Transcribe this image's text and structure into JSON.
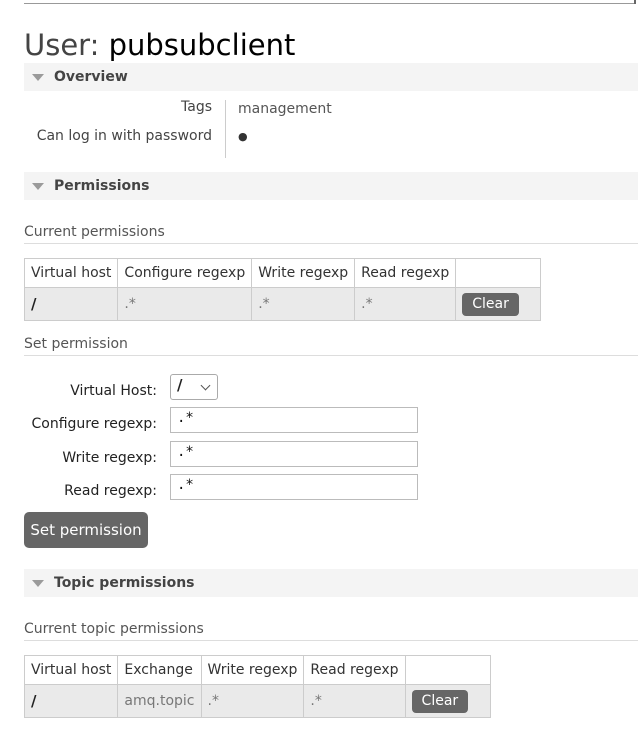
{
  "page": {
    "title_prefix": "User:",
    "user_name": "pubsubclient"
  },
  "overview": {
    "heading": "Overview",
    "tags_label": "Tags",
    "tags_value": "management",
    "password_label": "Can log in with password",
    "password_value": "●"
  },
  "permissions": {
    "heading": "Permissions",
    "current_heading": "Current permissions",
    "columns": [
      "Virtual host",
      "Configure regexp",
      "Write regexp",
      "Read regexp"
    ],
    "rows": [
      {
        "vhost": "/",
        "configure": ".*",
        "write": ".*",
        "read": ".*",
        "action": "Clear"
      }
    ],
    "set_heading": "Set permission",
    "form": {
      "vhost_label": "Virtual Host:",
      "vhost_value": "/",
      "configure_label": "Configure regexp:",
      "configure_value": ".*",
      "write_label": "Write regexp:",
      "write_value": ".*",
      "read_label": "Read regexp:",
      "read_value": ".*",
      "submit_label": "Set permission"
    }
  },
  "topic_permissions": {
    "heading": "Topic permissions",
    "current_heading": "Current topic permissions",
    "columns": [
      "Virtual host",
      "Exchange",
      "Write regexp",
      "Read regexp"
    ],
    "rows": [
      {
        "vhost": "/",
        "exchange": "amq.topic",
        "write": ".*",
        "read": ".*",
        "action": "Clear"
      }
    ]
  },
  "icons": {
    "section_toggle": "triangle-down-icon",
    "select_arrow": "chevron-down-icon"
  },
  "colors": {
    "button_bg": "#666666",
    "section_bg": "#f4f4f4",
    "row_bg": "#eaeaea"
  }
}
